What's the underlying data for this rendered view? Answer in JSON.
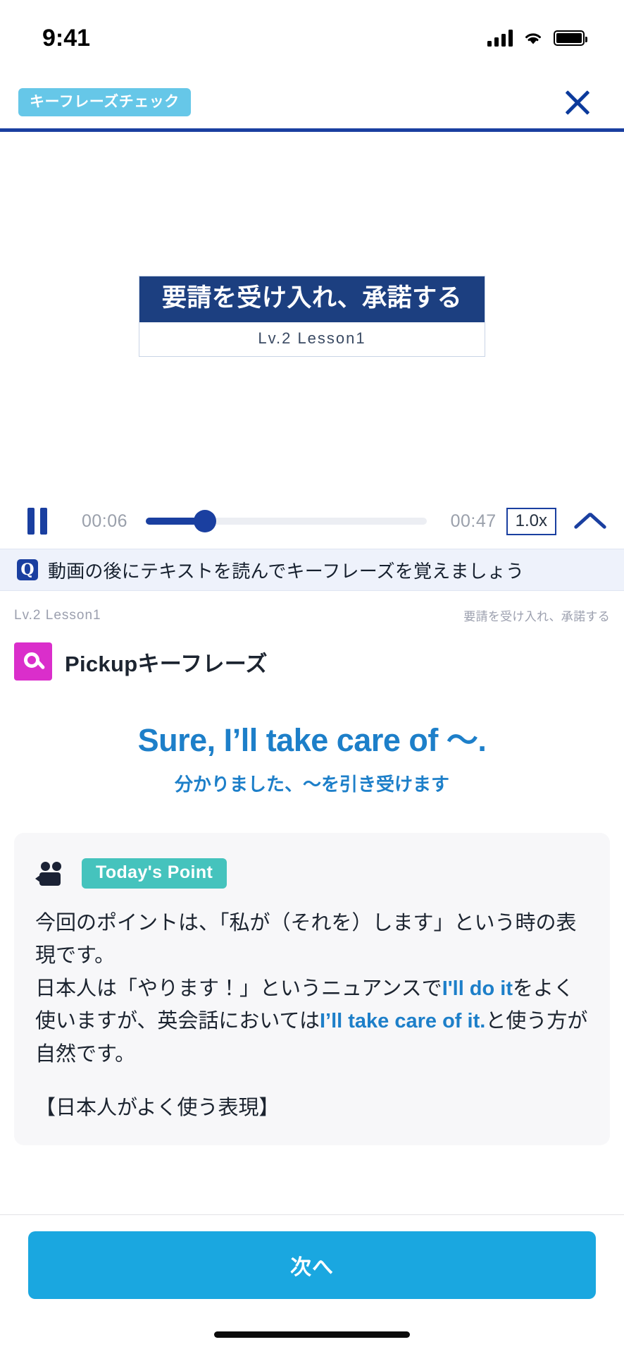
{
  "status_bar": {
    "time": "9:41",
    "icons": [
      "cellular-signal-icon",
      "wifi-icon",
      "battery-icon"
    ]
  },
  "top_bar": {
    "chip_label": "キーフレーズチェック",
    "close_label": "×"
  },
  "video": {
    "slide_title": "要請を受け入れ、承諾する",
    "slide_subtitle": "Lv.2 Lesson1"
  },
  "player": {
    "state": "playing",
    "current_time": "00:06",
    "duration": "00:47",
    "progress_percent": 21,
    "speed_label": "1.0x",
    "collapse_icon": "chevron-up-icon"
  },
  "notice": {
    "icon": "quote-mark-icon",
    "text": "動画の後にテキストを読んでキーフレーズを覚えましょう"
  },
  "lesson": {
    "level": "Lv.2 Lesson1",
    "title": "要請を受け入れ、承諾する"
  },
  "pickup": {
    "icon": "search-icon",
    "label": "Pickupキーフレーズ"
  },
  "phrase": {
    "english": "Sure, I’ll take care of 〜.",
    "japanese": "分かりました、〜を引き受けます"
  },
  "todays_point": {
    "icon": "video-camera-icon",
    "badge_label": "Today's Point",
    "paragraph1_a": "今回のポイントは、「私が（それを）します」という時の",
    "paragraph1_b": "表現です。",
    "paragraph2_a": "日本人は「やります！」というニュアンスで",
    "paragraph2_hl1": "I'll do it",
    "paragraph2_b": "をよく使いますが、英会話においては",
    "paragraph2_hl2": "I’ll take care of it.",
    "paragraph2_c": "と使う方が自然です。",
    "paragraph3": "【日本人がよく使う表現】"
  },
  "footer": {
    "next_label": "次へ"
  },
  "colors": {
    "brand_blue": "#1a3fa0",
    "accent_cyan": "#1aa7e0",
    "chip_cyan": "#66c7e8",
    "pickup_magenta": "#da2ecb",
    "today_teal": "#45c3bd",
    "phrase_blue": "#1d7fc9",
    "slide_navy": "#1c3f80"
  }
}
